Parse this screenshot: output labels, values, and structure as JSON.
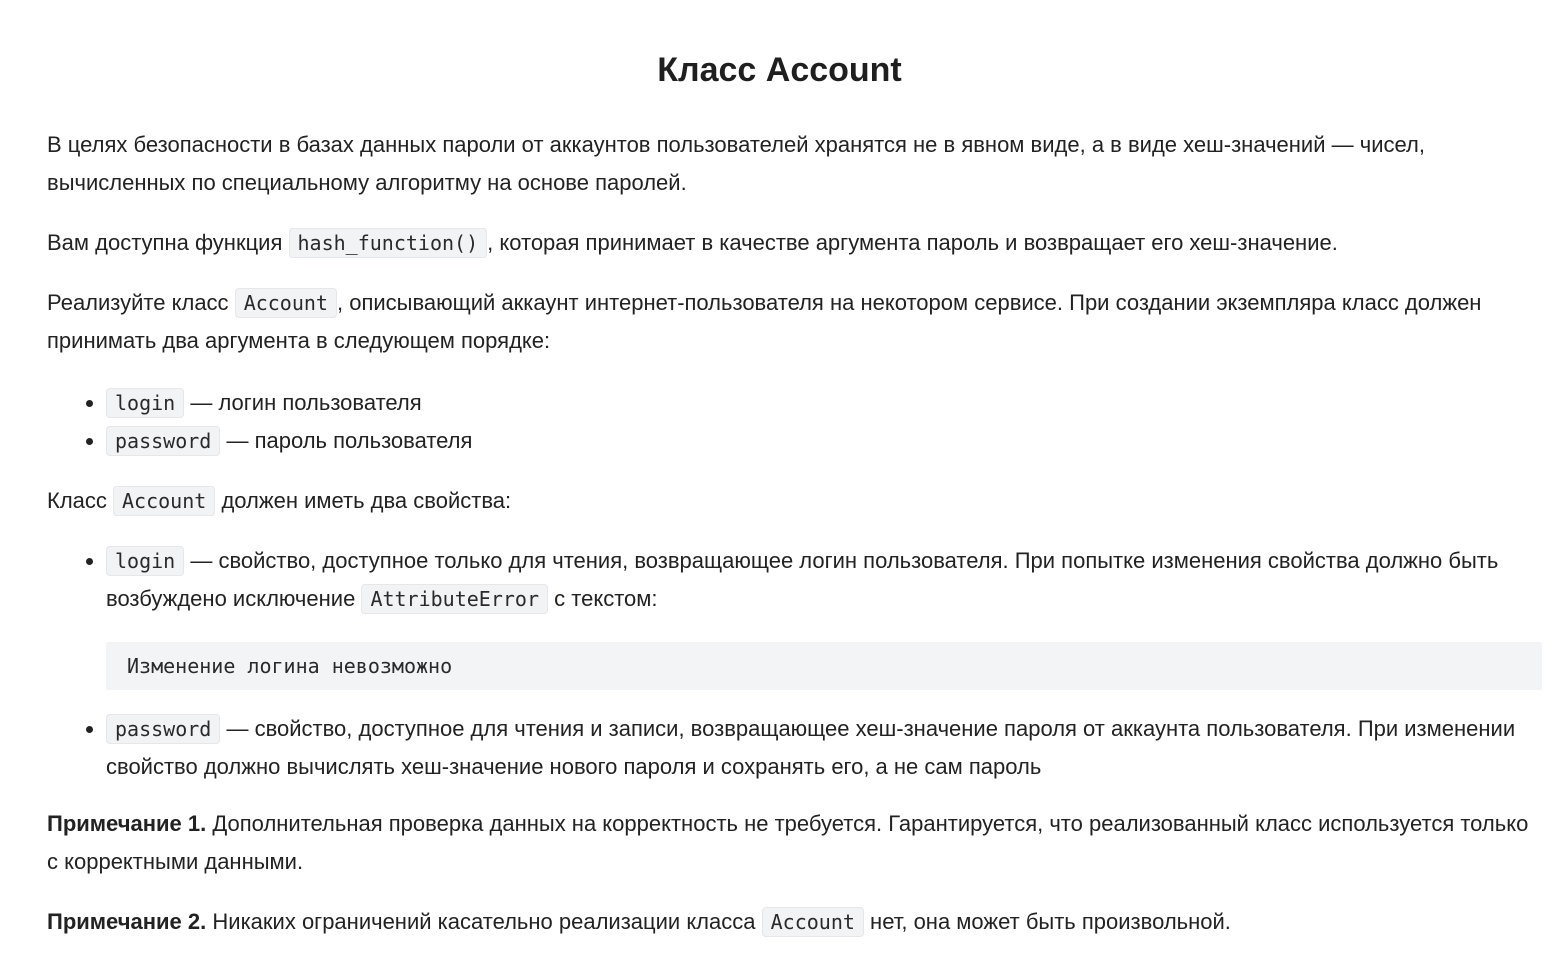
{
  "title": "Класс Account",
  "para1": "В целях безопасности в базах данных пароли от аккаунтов пользователей хранятся не в явном виде, а в виде хеш-значений — чисел, вычисленных по специальному алгоритму на основе паролей.",
  "para2": {
    "before": "Вам доступна функция",
    "code": "hash_function()",
    "after": ", которая принимает в качестве аргумента пароль и возвращает его хеш-значение."
  },
  "para3": {
    "before": "Реализуйте класс",
    "code": "Account",
    "after": ", описывающий аккаунт интернет-пользователя на некотором сервисе. При создании экземпляра класс должен принимать два аргумента в следующем порядке:"
  },
  "args": [
    {
      "code": "login",
      "text": "— логин пользователя"
    },
    {
      "code": "password",
      "text": "— пароль пользователя"
    }
  ],
  "para4": {
    "before": "Класс",
    "code": "Account",
    "after": "должен иметь два свойства:"
  },
  "properties": [
    {
      "code": "login",
      "text": "— свойство, доступное только для чтения, возвращающее логин пользователя. При попытке изменения свойства должно быть возбуждено исключение",
      "code2": "AttributeError",
      "text2": "с текстом:",
      "block": "Изменение логина невозможно"
    },
    {
      "code": "password",
      "text": "— свойство, доступное для чтения и записи, возвращающее хеш-значение пароля от аккаунта пользователя. При изменении свойство должно вычислять хеш-значение нового пароля и сохранять его, а не сам пароль"
    }
  ],
  "note1": {
    "label": "Примечание 1.",
    "text": "Дополнительная проверка данных на корректность не требуется. Гарантируется, что реализованный класс используется только с корректными данными."
  },
  "note2": {
    "label": "Примечание 2.",
    "before": "Никаких ограничений касательно реализации класса",
    "code": "Account",
    "after": "нет, она может быть произвольной."
  }
}
